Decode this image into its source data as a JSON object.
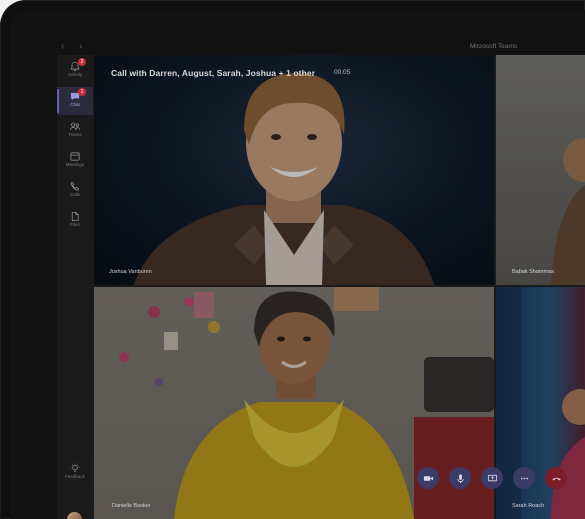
{
  "window": {
    "title": "Microsoft Teams",
    "back": "‹",
    "forward": "›"
  },
  "rail": {
    "items": [
      {
        "label": "Activity",
        "icon": "bell-icon",
        "badge": "2"
      },
      {
        "label": "Chat",
        "icon": "chat-icon",
        "badge": "1",
        "active": true
      },
      {
        "label": "Teams",
        "icon": "teams-icon",
        "badge": ""
      },
      {
        "label": "Meetings",
        "icon": "calendar-icon",
        "badge": ""
      },
      {
        "label": "Calls",
        "icon": "phone-icon",
        "badge": ""
      },
      {
        "label": "Files",
        "icon": "file-icon",
        "badge": ""
      }
    ],
    "feedback": "Feedback"
  },
  "call": {
    "title": "Call with Darren, August, Sarah, Joshua + 1 other",
    "timer": "00:05"
  },
  "participants": [
    {
      "name": "Joshua Vanburen"
    },
    {
      "name": "Babak Shammas"
    },
    {
      "name": "Danielle Booker"
    },
    {
      "name": "Sarah Roach"
    }
  ],
  "controls": [
    {
      "name": "camera-button",
      "icon": "video-camera-icon"
    },
    {
      "name": "microphone-button",
      "icon": "microphone-icon"
    },
    {
      "name": "share-screen-button",
      "icon": "share-screen-icon"
    },
    {
      "name": "more-options-button",
      "icon": "ellipsis-icon"
    },
    {
      "name": "hang-up-button",
      "icon": "hang-up-icon"
    }
  ],
  "colors": {
    "accent": "#6264a7",
    "badge": "#cc2d3a",
    "hangup": "#a4262c"
  }
}
